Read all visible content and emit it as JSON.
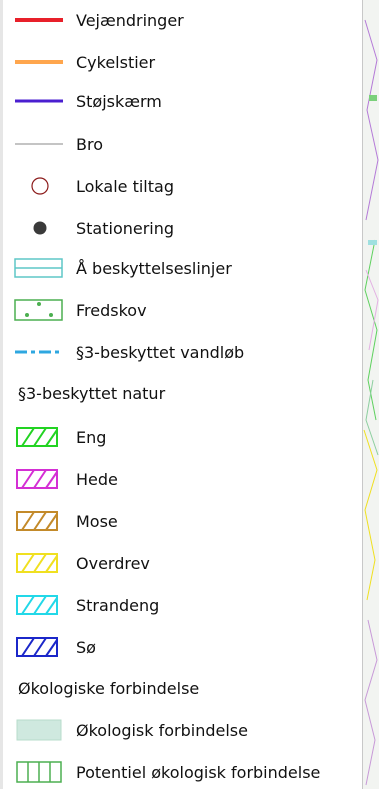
{
  "legend": {
    "items": [
      {
        "label": "Vejændringer",
        "icon": "red-line-icon",
        "color": "#e8202a"
      },
      {
        "label": "Cykelstier",
        "icon": "orange-line-icon",
        "color": "#ffa64d"
      },
      {
        "label": "Støjskærm",
        "icon": "purple-line-icon",
        "color": "#4a1fd0"
      },
      {
        "label": "Bro",
        "icon": "thin-gray-line-icon",
        "color": "#888888"
      },
      {
        "label": "Lokale tiltag",
        "icon": "hollow-circle-icon",
        "color": "#8b1a1a"
      },
      {
        "label": "Stationering",
        "icon": "filled-circle-icon",
        "color": "#3a3a3a"
      },
      {
        "label": "Å beskyttelseslinjer",
        "icon": "double-line-box-icon",
        "color": "#5fc7c7"
      },
      {
        "label": "Fredskov",
        "icon": "dotted-box-icon",
        "color": "#4caf50"
      },
      {
        "label": "§3-beskyttet vandløb",
        "icon": "dash-dot-line-icon",
        "color": "#2ea7e0"
      }
    ],
    "nature_heading": "§3-beskyttet natur",
    "nature_items": [
      {
        "label": "Eng",
        "icon": "hatch-green-icon",
        "color": "#22d322"
      },
      {
        "label": "Hede",
        "icon": "hatch-magenta-icon",
        "color": "#d42fd4"
      },
      {
        "label": "Mose",
        "icon": "hatch-brown-icon",
        "color": "#c38a2a"
      },
      {
        "label": "Overdrev",
        "icon": "hatch-yellow-icon",
        "color": "#f0e020"
      },
      {
        "label": "Strandeng",
        "icon": "hatch-cyan-icon",
        "color": "#22d8e8"
      },
      {
        "label": "Sø",
        "icon": "hatch-blue-icon",
        "color": "#1b27c9"
      }
    ],
    "eco_heading": "Økologiske forbindelse",
    "eco_items": [
      {
        "label": "Økologisk forbindelse",
        "icon": "filled-green-box-icon",
        "color": "#cfe9df"
      },
      {
        "label": "Potentiel økologisk forbindelse",
        "icon": "striped-green-box-icon",
        "color": "#4caf50"
      }
    ]
  }
}
